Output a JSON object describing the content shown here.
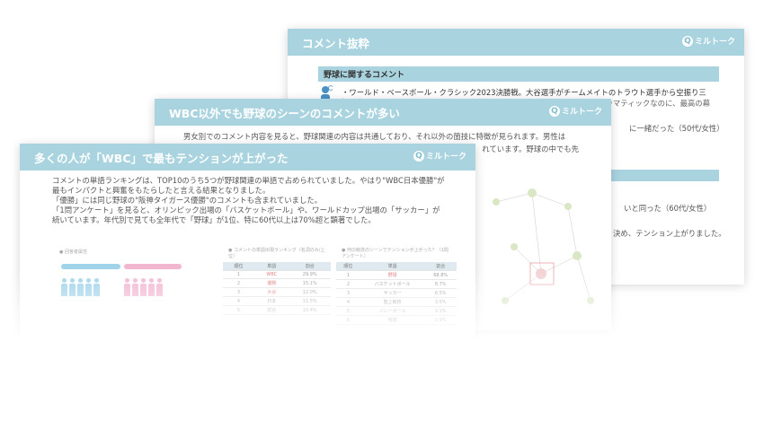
{
  "brand": {
    "logo_text": "ミルトーク",
    "accent": "#a8d3df"
  },
  "slide_back": {
    "title": "コメント抜粋",
    "section1": "野球に関するコメント",
    "quote1": "・ワールド・ベースボール・クラシック2023決勝戦。大谷選手がチームメイトのトラウト選手から空振り三振を奪っ",
    "quote2": "ドラマティックなのに、最高の幕",
    "quote3": "に一緒だった（50代/女性）",
    "quote4": "いと同った（60代/女性）",
    "quote5": "決め、テンション上がりました。"
  },
  "slide_middle": {
    "title": "WBC以外でも野球のシーンのコメントが多い",
    "line1": "男女別でのコメント内容を見ると、野球関連の内容は共通しており、それ以外の箇技に特徴が見られます。男性は",
    "line2": "れています。野球の中でも先"
  },
  "slide_front": {
    "title": "多くの人が「WBC」で最もテンションが上がった",
    "lines": [
      "コメントの単語ランキングは、TOP10のうち5つが野球関連の単語で占められていました。やはり\"WBC日本優勝\"が",
      "最もインパクトと興奮をもたらしたと言える結果となりました。",
      "「優勝」には同じ野球の\"阪神タイガース優勝\"のコメントも含まれていました。",
      "「1問アンケート」を見ると、オリンピック出場の「バスケットボール」や、ワールドカップ出場の「サッカー」が",
      "続いています。年代別で見ても全年代で「野球」が1位、特に60代以上は70%超と顕著でした。"
    ],
    "chart1_title": "● 回答者属性",
    "chart2_title": "● コメントの単語出現ランキング（名詞のみ/上位）",
    "chart3_title": "● 何の競技のシーンでテンションが上がった？（1問アンケート）",
    "table2": {
      "headers": [
        "順位",
        "単語",
        "割合"
      ],
      "rows": [
        [
          "1",
          "WBC",
          "29.9%"
        ],
        [
          "2",
          "優勝",
          "15.1%"
        ],
        [
          "3",
          "大谷",
          "12.0%"
        ],
        [
          "4",
          "日本",
          "11.5%"
        ],
        [
          "5",
          "試合",
          "10.4%"
        ]
      ]
    },
    "table3": {
      "headers": [
        "順位",
        "単語",
        "割合"
      ],
      "rows": [
        [
          "1",
          "野球",
          "68.8%"
        ],
        [
          "2",
          "バスケットボール",
          "8.7%"
        ],
        [
          "3",
          "サッカー",
          "6.5%"
        ],
        [
          "4",
          "陸上競技",
          "3.5%"
        ],
        [
          "5",
          "バレーボール",
          "3.1%"
        ],
        [
          "6",
          "格闘",
          "2.9%"
        ]
      ]
    }
  }
}
